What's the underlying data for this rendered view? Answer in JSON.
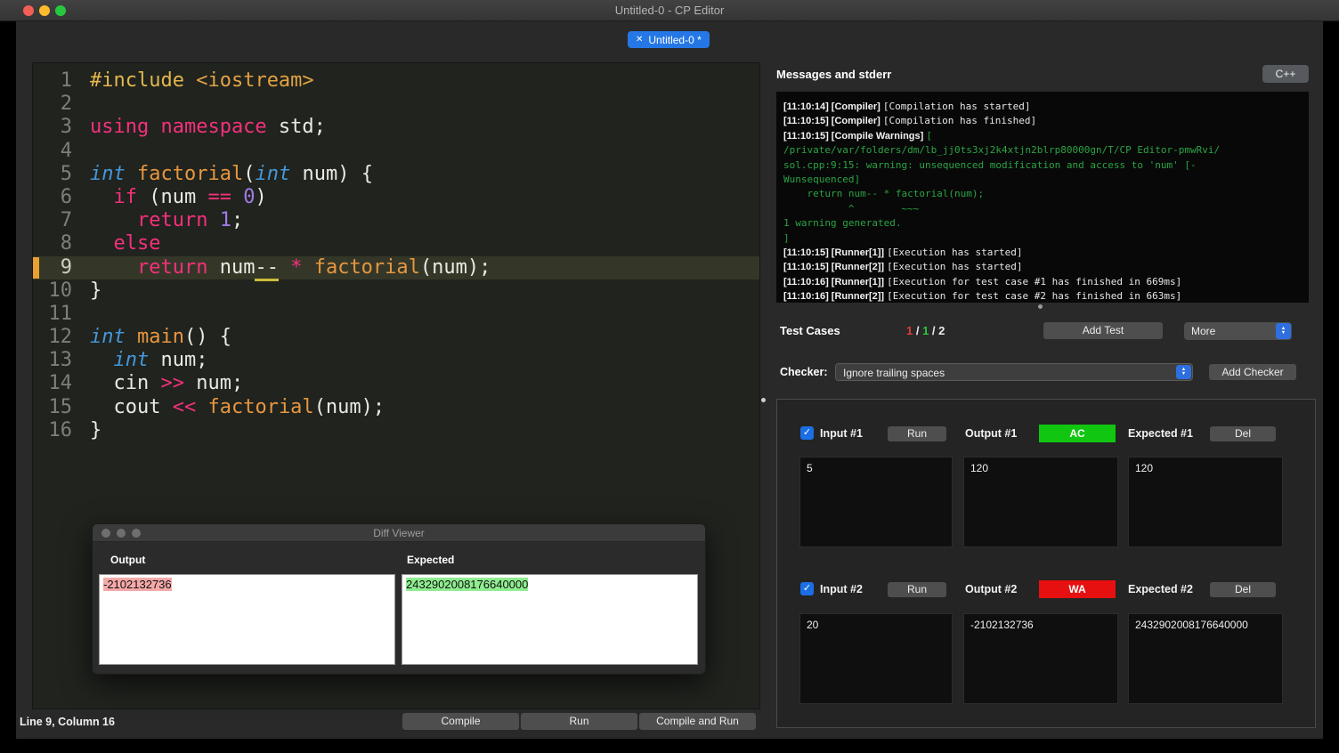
{
  "titlebar": {
    "title": "Untitled-0 - CP Editor"
  },
  "tab": {
    "close_icon": "✕",
    "label": "Untitled-0 *"
  },
  "editor": {
    "current_line": 9,
    "status": "Line 9, Column 16",
    "lines": [
      {
        "n": 1,
        "tokens": [
          {
            "c": "pp",
            "t": "#include "
          },
          {
            "c": "str",
            "t": "<iostream>"
          }
        ]
      },
      {
        "n": 2,
        "tokens": []
      },
      {
        "n": 3,
        "tokens": [
          {
            "c": "kw",
            "t": "using namespace"
          },
          {
            "c": "pl",
            "t": " std;"
          }
        ]
      },
      {
        "n": 4,
        "tokens": []
      },
      {
        "n": 5,
        "tokens": [
          {
            "c": "ty",
            "t": "int"
          },
          {
            "c": "pl",
            "t": " "
          },
          {
            "c": "fn",
            "t": "factorial"
          },
          {
            "c": "pl",
            "t": "("
          },
          {
            "c": "ty",
            "t": "int"
          },
          {
            "c": "pl",
            "t": " num) {"
          }
        ]
      },
      {
        "n": 6,
        "tokens": [
          {
            "c": "pl",
            "t": "  "
          },
          {
            "c": "kw",
            "t": "if"
          },
          {
            "c": "pl",
            "t": " (num "
          },
          {
            "c": "op",
            "t": "=="
          },
          {
            "c": "pl",
            "t": " "
          },
          {
            "c": "num",
            "t": "0"
          },
          {
            "c": "pl",
            "t": ")"
          }
        ]
      },
      {
        "n": 7,
        "tokens": [
          {
            "c": "pl",
            "t": "    "
          },
          {
            "c": "kw",
            "t": "return"
          },
          {
            "c": "pl",
            "t": " "
          },
          {
            "c": "num",
            "t": "1"
          },
          {
            "c": "pl",
            "t": ";"
          }
        ]
      },
      {
        "n": 8,
        "tokens": [
          {
            "c": "pl",
            "t": "  "
          },
          {
            "c": "kw",
            "t": "else"
          }
        ]
      },
      {
        "n": 9,
        "tokens": [
          {
            "c": "pl",
            "t": "    "
          },
          {
            "c": "kw",
            "t": "return"
          },
          {
            "c": "pl",
            "t": " num"
          },
          {
            "c": "warn",
            "t": "--"
          },
          {
            "c": "pl",
            "t": " "
          },
          {
            "c": "op",
            "t": "*"
          },
          {
            "c": "pl",
            "t": " "
          },
          {
            "c": "fn",
            "t": "factorial"
          },
          {
            "c": "pl",
            "t": "(num);"
          }
        ]
      },
      {
        "n": 10,
        "tokens": [
          {
            "c": "pl",
            "t": "}"
          }
        ]
      },
      {
        "n": 11,
        "tokens": []
      },
      {
        "n": 12,
        "tokens": [
          {
            "c": "ty",
            "t": "int"
          },
          {
            "c": "pl",
            "t": " "
          },
          {
            "c": "fn",
            "t": "main"
          },
          {
            "c": "pl",
            "t": "() {"
          }
        ]
      },
      {
        "n": 13,
        "tokens": [
          {
            "c": "pl",
            "t": "  "
          },
          {
            "c": "ty",
            "t": "int"
          },
          {
            "c": "pl",
            "t": " num;"
          }
        ]
      },
      {
        "n": 14,
        "tokens": [
          {
            "c": "pl",
            "t": "  cin "
          },
          {
            "c": "op",
            "t": ">>"
          },
          {
            "c": "pl",
            "t": " num;"
          }
        ]
      },
      {
        "n": 15,
        "tokens": [
          {
            "c": "pl",
            "t": "  cout "
          },
          {
            "c": "op",
            "t": "<<"
          },
          {
            "c": "pl",
            "t": " "
          },
          {
            "c": "fn",
            "t": "factorial"
          },
          {
            "c": "pl",
            "t": "(num);"
          }
        ]
      },
      {
        "n": 16,
        "tokens": [
          {
            "c": "pl",
            "t": "}"
          }
        ]
      }
    ]
  },
  "action_buttons": {
    "compile": "Compile",
    "run": "Run",
    "compile_and_run": "Compile and Run"
  },
  "messages_panel": {
    "title": "Messages and stderr",
    "language_button": "C++",
    "lines": [
      [
        {
          "s": "b",
          "t": "[11:10:14] [Compiler] "
        },
        {
          "s": "m",
          "t": "[Compilation has started]"
        }
      ],
      [
        {
          "s": "b",
          "t": "[11:10:15] [Compiler] "
        },
        {
          "s": "m",
          "t": "[Compilation has finished]"
        }
      ],
      [
        {
          "s": "b",
          "t": "[11:10:15] [Compile Warnings] "
        },
        {
          "s": "g",
          "t": "["
        }
      ],
      [
        {
          "s": "g",
          "t": "/private/var/folders/dm/lb_jj0ts3xj2k4xtjn2blrp80000gn/T/CP Editor-pmwRvi/"
        }
      ],
      [
        {
          "s": "g",
          "t": "sol.cpp:9:15: warning: unsequenced modification and access to 'num' [-"
        }
      ],
      [
        {
          "s": "g",
          "t": "Wunsequenced]"
        }
      ],
      [
        {
          "s": "g",
          "t": "    return num-- * factorial(num);"
        }
      ],
      [
        {
          "s": "g",
          "t": "           ^        ~~~"
        }
      ],
      [
        {
          "s": "g",
          "t": "1 warning generated."
        }
      ],
      [
        {
          "s": "g",
          "t": "]"
        }
      ],
      [
        {
          "s": "b",
          "t": "[11:10:15] [Runner[1]] "
        },
        {
          "s": "m",
          "t": "[Execution has started]"
        }
      ],
      [
        {
          "s": "b",
          "t": "[11:10:15] [Runner[2]] "
        },
        {
          "s": "m",
          "t": "[Execution has started]"
        }
      ],
      [
        {
          "s": "b",
          "t": "[11:10:16] [Runner[1]] "
        },
        {
          "s": "m",
          "t": "[Execution for test case #1 has finished in 669ms]"
        }
      ],
      [
        {
          "s": "b",
          "t": "[11:10:16] [Runner[2]] "
        },
        {
          "s": "m",
          "t": "[Execution for test case #2 has finished in 663ms]"
        }
      ]
    ]
  },
  "test_cases": {
    "section_label": "Test Cases",
    "counts": [
      {
        "t": "1",
        "c": "red"
      },
      {
        "t": " / ",
        "c": "plain"
      },
      {
        "t": "1",
        "c": "green"
      },
      {
        "t": " / ",
        "c": "plain"
      },
      {
        "t": "2",
        "c": "plain"
      }
    ],
    "add_test_button": "Add Test",
    "more_button": "More",
    "checker_label": "Checker:",
    "checker_value": "Ignore trailing spaces",
    "add_checker_button": "Add Checker",
    "cases": [
      {
        "input_label": "Input #1",
        "run_button": "Run",
        "output_label": "Output #1",
        "verdict": "AC",
        "expected_label": "Expected #1",
        "del_button": "Del",
        "input_value": "5",
        "output_value": "120",
        "expected_value": "120"
      },
      {
        "input_label": "Input #2",
        "run_button": "Run",
        "output_label": "Output #2",
        "verdict": "WA",
        "expected_label": "Expected #2",
        "del_button": "Del",
        "input_value": "20",
        "output_value": "-2102132736",
        "expected_value": "2432902008176640000"
      }
    ]
  },
  "diff_viewer": {
    "title": "Diff Viewer",
    "output_label": "Output",
    "expected_label": "Expected",
    "output_value": "-2102132736",
    "expected_value": "2432902008176640000"
  },
  "colors": {
    "accent_blue": "#2577e6",
    "ac_green": "#10c610",
    "wa_red": "#e71010",
    "warning_green": "#2ba444",
    "keyword_pink": "#f5307c",
    "current_line_marker": "#e8a02e",
    "diff_removed_bg": "#f6a9a9",
    "diff_added_bg": "#8fee90"
  },
  "icons": {
    "check": "✓",
    "close": "✕",
    "dropdown_up": "▲",
    "dropdown_down": "▼"
  }
}
